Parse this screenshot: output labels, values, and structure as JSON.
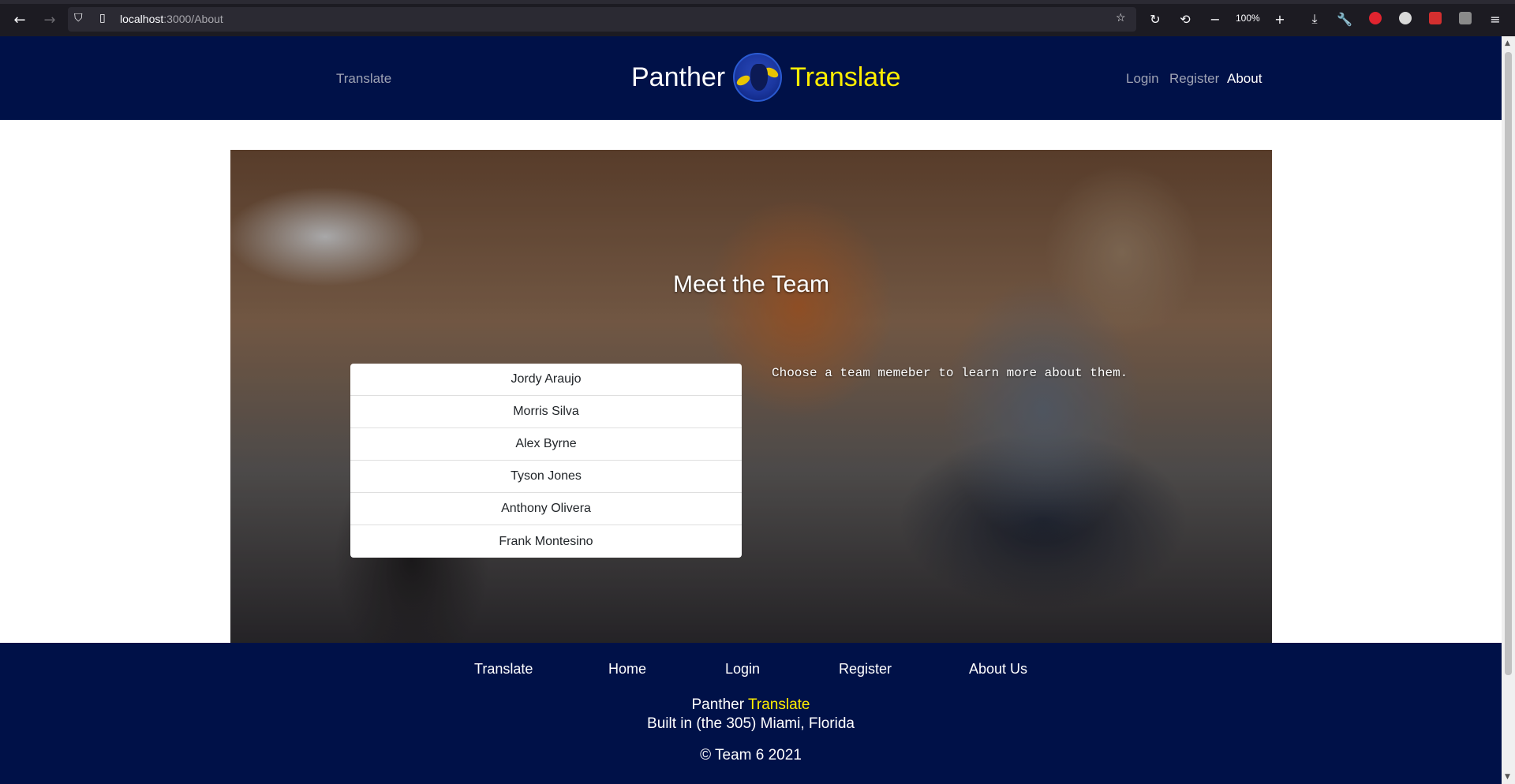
{
  "browser": {
    "url_host": "localhost",
    "url_path": ":3000/About",
    "zoom": "100%",
    "icons": {
      "back": "arrow-left-icon",
      "forward": "arrow-right-icon",
      "shield": "shield-icon",
      "page": "page-icon",
      "bookmark": "star-icon",
      "reload": "reload-icon",
      "history": "history-icon",
      "zoom_out": "minus-icon",
      "zoom_in": "plus-icon",
      "downloads": "download-icon",
      "tools": "wrench-icon",
      "menu": "hamburger-icon"
    }
  },
  "header": {
    "nav_left": "Translate",
    "brand_first": "Panther",
    "brand_second": "Translate",
    "nav_right": [
      "Login",
      "Register",
      "About"
    ],
    "active": "About",
    "colors": {
      "background": "#001148",
      "accent": "#ffee00"
    }
  },
  "hero": {
    "title": "Meet the Team",
    "hint": "Choose a team memeber to learn more about them.",
    "team": [
      "Jordy Araujo",
      "Morris Silva",
      "Alex Byrne",
      "Tyson Jones",
      "Anthony Olivera",
      "Frank Montesino"
    ]
  },
  "footer": {
    "links": [
      "Translate",
      "Home",
      "Login",
      "Register",
      "About Us"
    ],
    "brand_first": "Panther",
    "brand_second": "Translate",
    "built": "Built in (the 305) Miami, Florida",
    "copyright": "© Team 6 2021"
  }
}
